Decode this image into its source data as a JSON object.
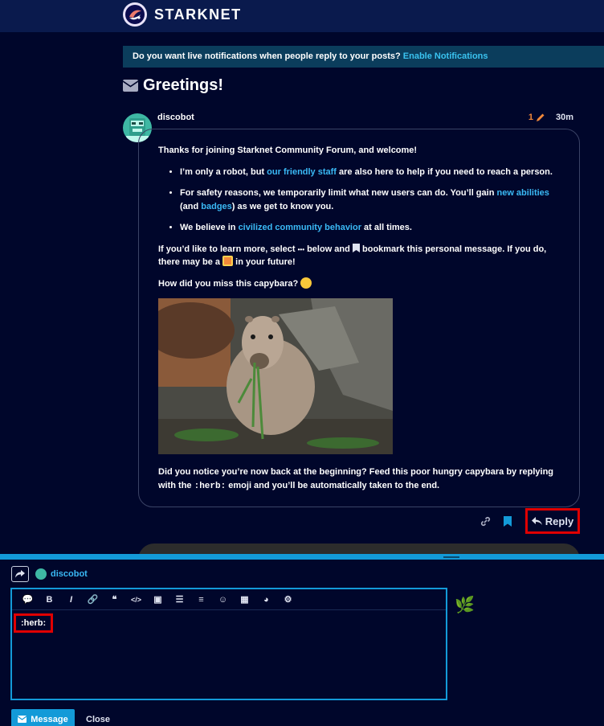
{
  "header": {
    "brand": "STARKNET",
    "logo_icon": "starknet-logo-icon"
  },
  "notice": {
    "text": "Do you want live notifications when people reply to your posts?",
    "link": "Enable Notifications"
  },
  "topic": {
    "title": "Greetings!",
    "icon": "envelope-icon"
  },
  "post": {
    "username": "discobot",
    "edit_count": "1",
    "age": "30m",
    "intro": "Thanks for joining Starknet Community Forum, and welcome!",
    "bullets": [
      {
        "before": "I’m only a robot, but ",
        "link": "our friendly staff",
        "after": " are also here to help if you need to reach a person."
      },
      {
        "before": "For safety reasons, we temporarily limit what new users can do. You’ll gain ",
        "link": "new abilities",
        "middle": " (and ",
        "link2": "badges",
        "after": ") as we get to know you."
      },
      {
        "before": "We believe in ",
        "link": "civilized community behavior",
        "after": " at all times."
      }
    ],
    "learn_a": "If you’d like to learn more, select ",
    "learn_ellipsis": "•••",
    "learn_b": " below and ",
    "learn_bookmark": "bookmark this personal message",
    "learn_c": ". If you do, there may be a ",
    "learn_d": " in your future!",
    "question": "How did you miss this capybara?",
    "outro_a": "Did you notice you’re now back at the beginning? Feed this poor hungry capybara by ",
    "outro_bold": "replying with the ",
    "outro_code": ":herb:",
    "outro_b": " emoji and you’ll be automatically taken to the end."
  },
  "actions": {
    "reply": "Reply"
  },
  "composer": {
    "reply_to": "discobot",
    "text": ":herb:",
    "message_button": "Message",
    "close_button": "Close",
    "preview_emoji": "🌿",
    "toolbar": [
      {
        "name": "quote-icon",
        "glyph": "💬"
      },
      {
        "name": "bold-icon",
        "glyph": "B"
      },
      {
        "name": "italic-icon",
        "glyph": "I"
      },
      {
        "name": "link-icon",
        "glyph": "🔗"
      },
      {
        "name": "blockquote-icon",
        "glyph": "❝"
      },
      {
        "name": "code-icon",
        "glyph": "</>"
      },
      {
        "name": "image-icon",
        "glyph": "▣"
      },
      {
        "name": "bullet-list-icon",
        "glyph": "☰"
      },
      {
        "name": "numbered-list-icon",
        "glyph": "≡"
      },
      {
        "name": "emoji-icon",
        "glyph": "☺"
      },
      {
        "name": "calendar-icon",
        "glyph": "▦"
      },
      {
        "name": "palette-icon",
        "glyph": "◕"
      },
      {
        "name": "gear-icon",
        "glyph": "⚙"
      }
    ]
  },
  "colors": {
    "accent": "#139ad8",
    "link": "#3ab9f5",
    "highlight": "#e00000",
    "edit": "#f3893a"
  }
}
